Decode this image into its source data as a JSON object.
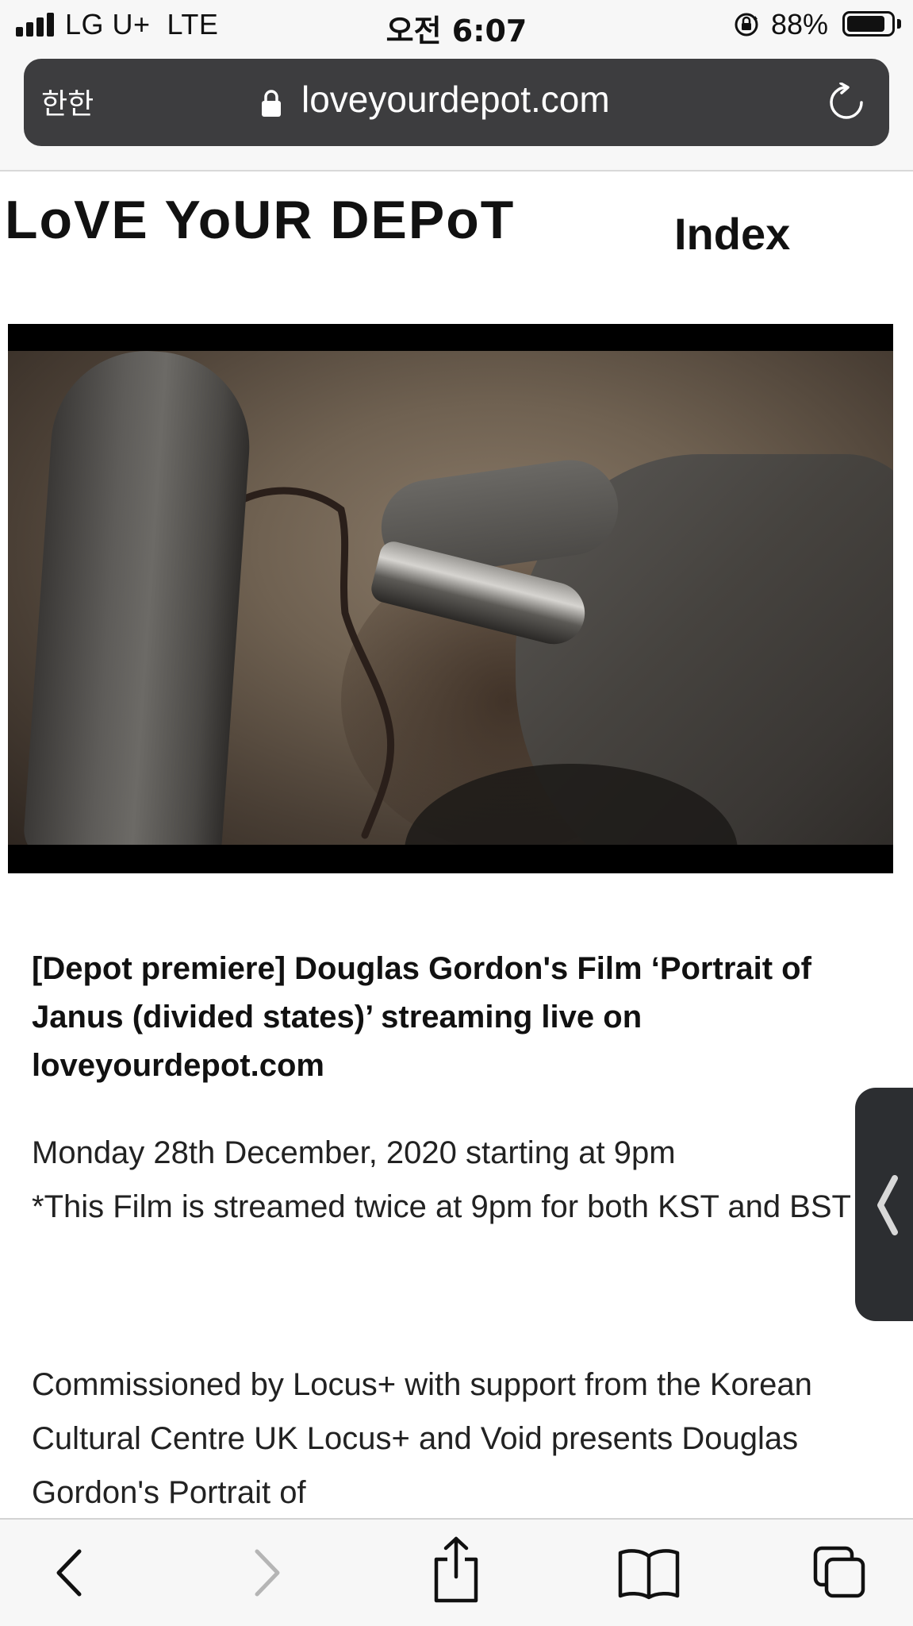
{
  "status_bar": {
    "carrier": "LG U+  LTE",
    "time": "오전 6:07",
    "battery_percent": "88%",
    "battery_level": 0.88
  },
  "browser": {
    "reader_button": "한한",
    "url": "loveyourdepot.com"
  },
  "site": {
    "logo": "LoVE YoUR DEPoT",
    "nav_index": "Index"
  },
  "article": {
    "title": "[Depot premiere] Douglas Gordon's Film ‘Portrait of Janus (divided states)’ streaming live on loveyourdepot.com",
    "date_line_1": "Monday 28th December, 2020 starting at 9pm",
    "date_line_2": "*This Film is streamed twice at 9pm for both KST and BST",
    "body": "Commissioned by Locus+ with support from the Korean Cultural Centre UK Locus+ and Void presents Douglas Gordon's Portrait of"
  },
  "icons": {
    "lock": "lock-icon",
    "reload": "reload-icon",
    "back": "chevron-left-icon",
    "forward": "chevron-right-icon",
    "share": "share-icon",
    "bookmarks": "book-icon",
    "tabs": "tabs-icon",
    "side_handle": "chevron-left-icon"
  },
  "colors": {
    "url_bar_bg": "#3d3d3f",
    "chrome_bg": "#f7f7f7",
    "text": "#111111",
    "forward_disabled": "#b5b5b5"
  }
}
